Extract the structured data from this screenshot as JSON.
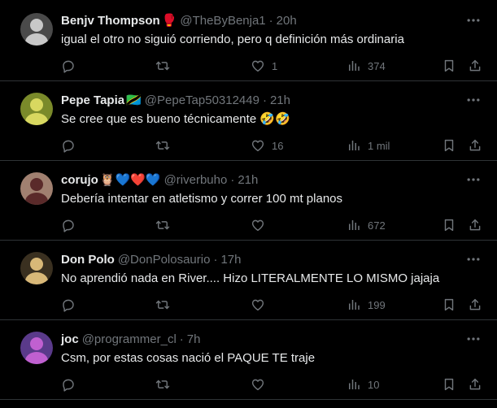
{
  "replies": [
    {
      "name": "Benjv Thompson",
      "emoji": "🥊",
      "handle": "@TheByBenja1",
      "time": "20h",
      "text": "igual el otro no siguió corriendo, pero q definición más ordinaria",
      "likes": "1",
      "views": "374",
      "avatar": {
        "bg": "#4a4a4a",
        "fg": "#c8c8c8"
      }
    },
    {
      "name": "Pepe Tapia",
      "emoji": "🇹🇿",
      "handle": "@PepeTap50312449",
      "time": "21h",
      "text": "Se cree que es bueno técnicamente 🤣🤣",
      "likes": "16",
      "views": "1 mil",
      "avatar": {
        "bg": "#7a8a2a",
        "fg": "#d8d860"
      }
    },
    {
      "name": "corujo",
      "emoji": "🦉💙❤️💙",
      "handle": "@riverbuho",
      "time": "21h",
      "text": "Debería intentar en atletismo y correr 100 mt planos",
      "likes": "",
      "views": "672",
      "avatar": {
        "bg": "#a08070",
        "fg": "#5a2a2a"
      }
    },
    {
      "name": "Don Polo",
      "emoji": "",
      "handle": "@DonPolosaurio",
      "time": "17h",
      "text": "No aprendió nada en River.... Hizo LITERALMENTE LO MISMO jajaja",
      "likes": "",
      "views": "199",
      "avatar": {
        "bg": "#3a3020",
        "fg": "#d8b878"
      }
    },
    {
      "name": "joc",
      "emoji": "",
      "handle": "@programmer_cl",
      "time": "7h",
      "text": "Csm, por estas cosas nació el PAQUE TE traje",
      "likes": "",
      "views": "10",
      "avatar": {
        "bg": "#5a3a8a",
        "fg": "#c060d0"
      }
    }
  ],
  "icons": {
    "reply": "reply-icon",
    "repost": "repost-icon",
    "like": "like-icon",
    "views": "views-icon",
    "bookmark": "bookmark-icon",
    "share": "share-icon",
    "more": "more-icon"
  },
  "colors": {
    "background": "#000000",
    "text": "#e7e9ea",
    "secondary": "#71767b",
    "divider": "#2f3336"
  }
}
